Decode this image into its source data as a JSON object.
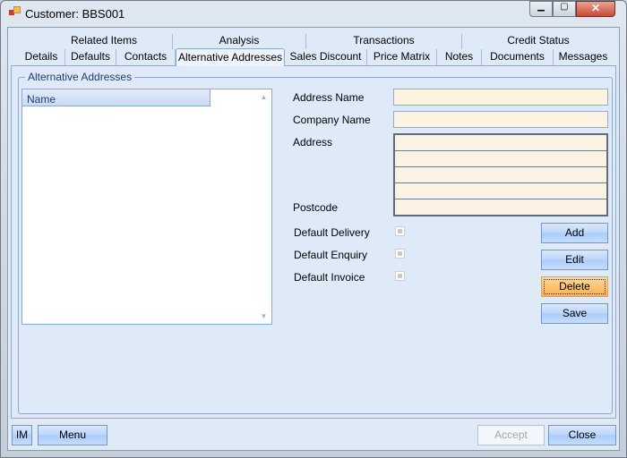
{
  "window": {
    "title": "Customer: BBS001"
  },
  "tabs_row1": [
    "Related Items",
    "Analysis",
    "Transactions",
    "Credit Status"
  ],
  "tabs_row2": [
    "Details",
    "Defaults",
    "Contacts",
    "Alternative Addresses",
    "Sales Discount",
    "Price Matrix",
    "Notes",
    "Documents",
    "Messages"
  ],
  "group": {
    "title": "Alternative Addresses"
  },
  "list": {
    "column": "Name"
  },
  "form": {
    "address_name": "Address Name",
    "company_name": "Company Name",
    "address": "Address",
    "postcode": "Postcode",
    "default_delivery": "Default Delivery",
    "default_enquiry": "Default Enquiry",
    "default_invoice": "Default Invoice"
  },
  "buttons": {
    "add": "Add",
    "edit": "Edit",
    "delete": "Delete",
    "save": "Save",
    "im": "IM",
    "menu": "Menu",
    "accept": "Accept",
    "close": "Close"
  }
}
